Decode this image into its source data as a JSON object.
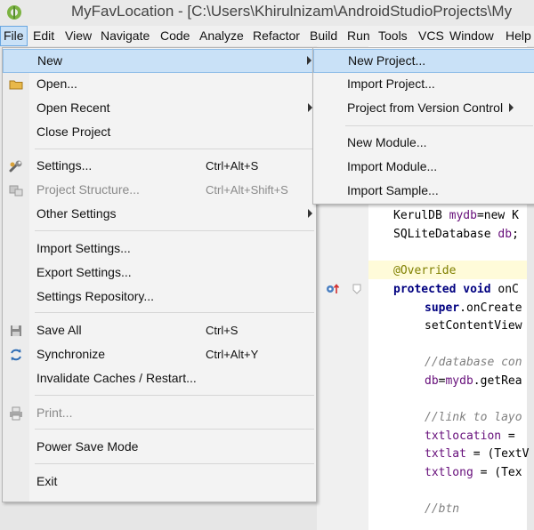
{
  "window": {
    "title": "MyFavLocation - [C:\\Users\\Khirulnizam\\AndroidStudioProjects\\My"
  },
  "menubar": [
    "File",
    "Edit",
    "View",
    "Navigate",
    "Code",
    "Analyze",
    "Refactor",
    "Build",
    "Run",
    "Tools",
    "VCS",
    "Window",
    "Help"
  ],
  "file_menu": {
    "items": [
      {
        "label": "New",
        "shortcut": "",
        "submenu": true,
        "highlighted": true
      },
      {
        "label": "Open...",
        "shortcut": "",
        "icon": "folder-icon"
      },
      {
        "label": "Open Recent",
        "shortcut": "",
        "submenu": true
      },
      {
        "label": "Close Project",
        "shortcut": ""
      },
      {
        "label": "Settings...",
        "shortcut": "Ctrl+Alt+S",
        "icon": "wrench-icon"
      },
      {
        "label": "Project Structure...",
        "shortcut": "Ctrl+Alt+Shift+S",
        "icon": "project-structure-icon",
        "disabled": true
      },
      {
        "label": "Other Settings",
        "shortcut": "",
        "submenu": true
      },
      {
        "label": "Import Settings...",
        "shortcut": ""
      },
      {
        "label": "Export Settings...",
        "shortcut": ""
      },
      {
        "label": "Settings Repository...",
        "shortcut": ""
      },
      {
        "label": "Save All",
        "shortcut": "Ctrl+S",
        "icon": "save-icon"
      },
      {
        "label": "Synchronize",
        "shortcut": "Ctrl+Alt+Y",
        "icon": "sync-icon"
      },
      {
        "label": "Invalidate Caches / Restart...",
        "shortcut": ""
      },
      {
        "label": "Print...",
        "shortcut": "",
        "icon": "print-icon",
        "disabled": true
      },
      {
        "label": "Power Save Mode",
        "shortcut": ""
      },
      {
        "label": "Exit",
        "shortcut": ""
      }
    ]
  },
  "new_submenu": {
    "items": [
      {
        "label": "New Project...",
        "highlighted": true
      },
      {
        "label": "Import Project..."
      },
      {
        "label": "Project from Version Control",
        "submenu": true
      },
      {
        "label": "New Module..."
      },
      {
        "label": "Import Module..."
      },
      {
        "label": "Import Sample..."
      }
    ]
  },
  "code": {
    "l1a": "KerulDB ",
    "l1b": "mydb",
    "l1c": "=new K",
    "l2a": "SQLiteDatabase ",
    "l2b": "db",
    "l2c": ";",
    "l3": "@Override",
    "l4a": "protected void ",
    "l4b": "onC",
    "l5a": "super",
    "l5b": ".onCreate",
    "l6": "setContentView",
    "l7": "//database con",
    "l8a": "db",
    "l8b": "=",
    "l8c": "mydb",
    "l8d": ".getRea",
    "l9": "//link to layo",
    "l10a": "txtlocation",
    "l10b": " =",
    "l11a": "txtlat",
    "l11b": " = (TextV",
    "l12a": "txtlong",
    "l12b": " = (Tex",
    "l13": "//btn"
  }
}
